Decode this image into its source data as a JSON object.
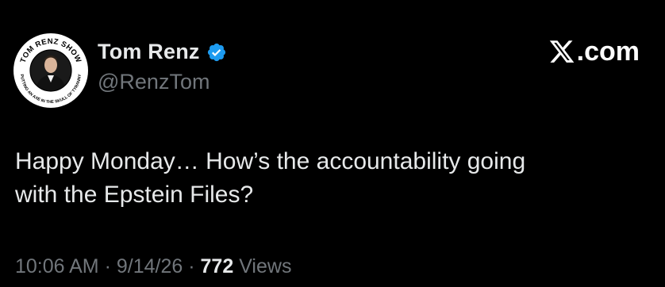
{
  "tweet": {
    "author": {
      "display_name": "Tom Renz",
      "handle": "@RenzTom",
      "verified": true,
      "avatar": {
        "top_text": "TOM RENZ SHOW",
        "bottom_text": "PUTTING AN AXE IN THE SKULL OF TYRANNY"
      }
    },
    "brand": {
      "logo": "x-logo-icon",
      "text": ".com"
    },
    "text_lines": [
      "Happy Monday… How’s the accountability going",
      "with the Epstein Files?"
    ],
    "meta": {
      "time": "10:06 AM",
      "date": "9/14/26",
      "separator": "·",
      "views_count": "772",
      "views_label": "Views"
    }
  },
  "colors": {
    "background": "#000000",
    "primary_text": "#e7e9ea",
    "secondary_text": "#71767b",
    "verified_badge": "#1d9bf0"
  }
}
